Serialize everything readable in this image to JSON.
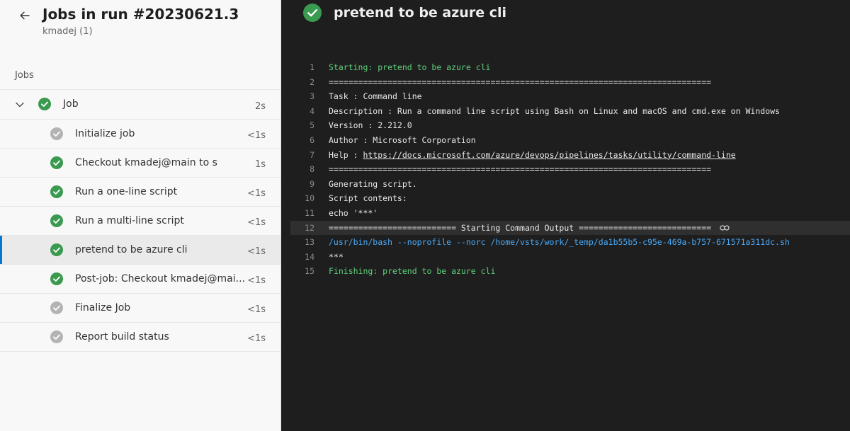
{
  "header": {
    "title": "Jobs in run #20230621.3",
    "subtitle": "kmadej (1)"
  },
  "section_label": "Jobs",
  "job": {
    "label": "Job",
    "duration": "2s",
    "status": "succeeded"
  },
  "steps": [
    {
      "label": "Initialize job",
      "duration": "<1s",
      "status": "neutral"
    },
    {
      "label": "Checkout kmadej@main to s",
      "duration": "1s",
      "status": "succeeded"
    },
    {
      "label": "Run a one-line script",
      "duration": "<1s",
      "status": "succeeded"
    },
    {
      "label": "Run a multi-line script",
      "duration": "<1s",
      "status": "succeeded"
    },
    {
      "label": "pretend to be azure cli",
      "duration": "<1s",
      "status": "succeeded",
      "selected": true
    },
    {
      "label": "Post-job: Checkout kmadej@mai...",
      "duration": "<1s",
      "status": "succeeded"
    },
    {
      "label": "Finalize Job",
      "duration": "<1s",
      "status": "neutral"
    },
    {
      "label": "Report build status",
      "duration": "<1s",
      "status": "neutral"
    }
  ],
  "log": {
    "title": "pretend to be azure cli",
    "lines": [
      {
        "n": "1",
        "text": "Starting: pretend to be azure cli"
      },
      {
        "n": "2",
        "text": "=============================================================================="
      },
      {
        "n": "3",
        "text": "Task         : Command line"
      },
      {
        "n": "4",
        "text": "Description  : Run a command line script using Bash on Linux and macOS and cmd.exe on Windows"
      },
      {
        "n": "5",
        "text": "Version      : 2.212.0"
      },
      {
        "n": "6",
        "text": "Author       : Microsoft Corporation"
      },
      {
        "n": "7",
        "text": "Help         : ",
        "link": "https://docs.microsoft.com/azure/devops/pipelines/tasks/utility/command-line"
      },
      {
        "n": "8",
        "text": "=============================================================================="
      },
      {
        "n": "9",
        "text": "Generating script."
      },
      {
        "n": "10",
        "text": "Script contents:"
      },
      {
        "n": "11",
        "text": "echo '***'"
      },
      {
        "n": "12",
        "text": "========================== Starting Command Output ==========================="
      },
      {
        "n": "13",
        "text": "/usr/bin/bash --noprofile --norc /home/vsts/work/_temp/da1b55b5-c95e-469a-b757-671571a311dc.sh"
      },
      {
        "n": "14",
        "text": "***"
      },
      {
        "n": "15",
        "text": "Finishing: pretend to be azure cli"
      }
    ]
  },
  "colors": {
    "success": "#3a9a4f",
    "neutral": "#b3b3b3",
    "accent": "#0078d4"
  },
  "icons": {
    "back": "arrow-left-icon",
    "chevron": "chevron-down-icon",
    "succeeded": "check-circle-icon",
    "neutral": "check-circle-gray-icon",
    "link": "link-icon"
  }
}
